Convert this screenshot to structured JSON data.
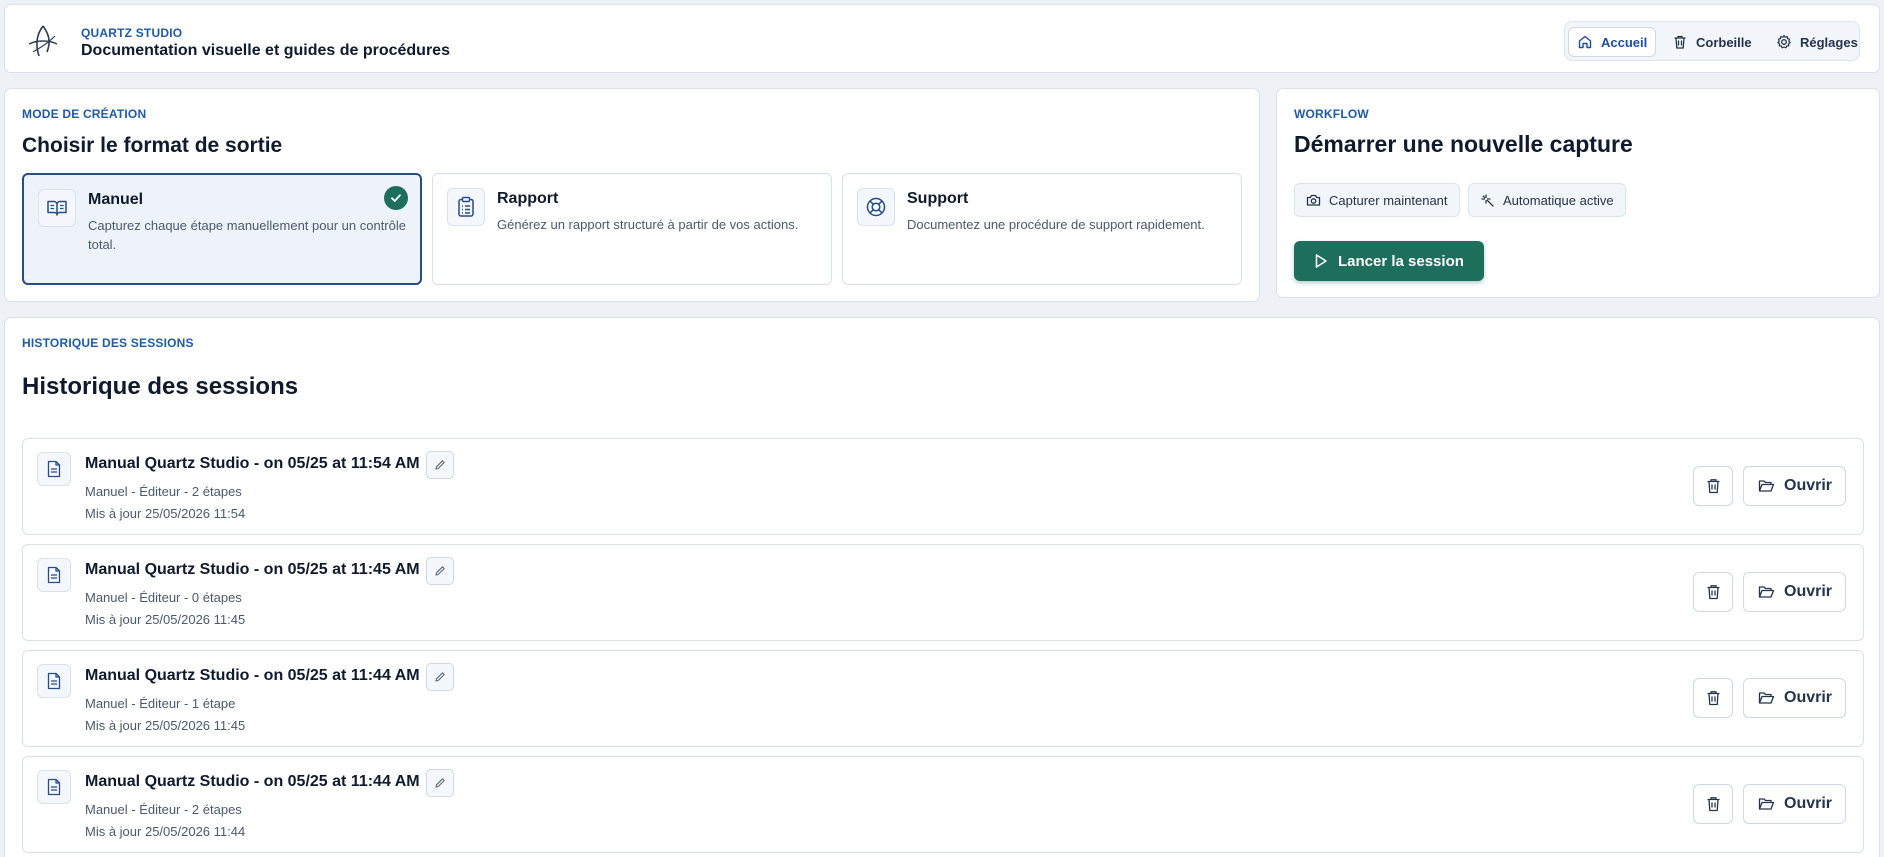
{
  "header": {
    "app_name": "QUARTZ STUDIO",
    "subtitle": "Documentation visuelle et guides de procédures",
    "nav": [
      {
        "label": "Accueil",
        "icon": "home-icon",
        "active": true
      },
      {
        "label": "Corbeille",
        "icon": "trash-icon",
        "active": false
      },
      {
        "label": "Réglages",
        "icon": "gear-icon",
        "active": false
      }
    ]
  },
  "mode": {
    "eyebrow": "MODE DE CRÉATION",
    "title": "Choisir le format de sortie",
    "options": [
      {
        "title": "Manuel",
        "description": "Capturez chaque étape manuellement pour un contrôle total.",
        "icon": "book-icon",
        "selected": true
      },
      {
        "title": "Rapport",
        "description": "Générez un rapport structuré à partir de vos actions.",
        "icon": "clipboard-icon",
        "selected": false
      },
      {
        "title": "Support",
        "description": "Documentez une procédure de support rapidement.",
        "icon": "lifebuoy-icon",
        "selected": false
      }
    ]
  },
  "workflow": {
    "eyebrow": "WORKFLOW",
    "title": "Démarrer une nouvelle capture",
    "capture_label": "Capturer maintenant",
    "auto_label": "Automatique active",
    "start_label": "Lancer la session"
  },
  "history": {
    "eyebrow": "HISTORIQUE DES SESSIONS",
    "title": "Historique des sessions",
    "open_label": "Ouvrir",
    "sessions": [
      {
        "title": "Manual Quartz Studio - on 05/25 at 11:54 AM",
        "meta": "Manuel - Éditeur - 2 étapes",
        "updated": "Mis à jour 25/05/2026 11:54"
      },
      {
        "title": "Manual Quartz Studio - on 05/25 at 11:45 AM",
        "meta": "Manuel - Éditeur - 0 étapes",
        "updated": "Mis à jour 25/05/2026 11:45"
      },
      {
        "title": "Manual Quartz Studio - on 05/25 at 11:44 AM",
        "meta": "Manuel - Éditeur - 1 étape",
        "updated": "Mis à jour 25/05/2026 11:45"
      },
      {
        "title": "Manual Quartz Studio - on 05/25 at 11:44 AM",
        "meta": "Manuel - Éditeur - 2 étapes",
        "updated": "Mis à jour 25/05/2026 11:44"
      }
    ]
  },
  "colors": {
    "accent": "#1d6f5c",
    "brand_blue": "#1f5aa8",
    "selected_border": "#264d86",
    "background": "#eef2f6"
  }
}
